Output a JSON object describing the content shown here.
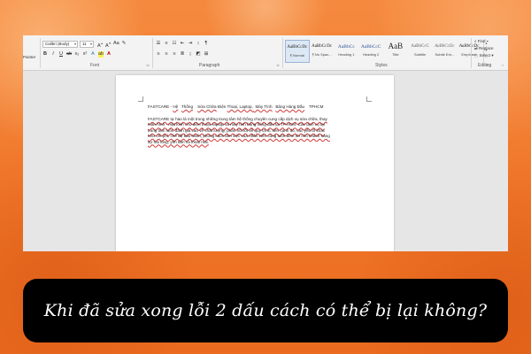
{
  "ribbon": {
    "clipboard_label": "Painter",
    "font": {
      "name": "Calibri (Body)",
      "size": "11",
      "group_label": "Font"
    },
    "paragraph_label": "Paragraph",
    "styles": {
      "group_label": "Styles",
      "items": [
        {
          "preview": "AaBbCcDc",
          "name": "¶ Normal"
        },
        {
          "preview": "AaBbCcDc",
          "name": "¶ No Spac..."
        },
        {
          "preview": "AaBbCc",
          "name": "Heading 1"
        },
        {
          "preview": "AaBbCcC",
          "name": "Heading 2"
        },
        {
          "preview": "AaB",
          "name": "Title"
        },
        {
          "preview": "AaBbCcC",
          "name": "Subtitle"
        },
        {
          "preview": "AaBbCcDc",
          "name": "Subtle Em..."
        },
        {
          "preview": "AaBbCcDc",
          "name": "Emphasis"
        }
      ]
    },
    "editing": {
      "find": "Find",
      "replace": "Replace",
      "select": "Select",
      "group_label": "Editing"
    }
  },
  "document": {
    "heading_line": [
      "FASTCARE - ",
      "Hệ",
      "   ",
      "Thống",
      "    ",
      "Sửa Chữa",
      " Điện ",
      "Thoại, Laptop,",
      "  Máy Tính",
      "   ",
      "Bảng Hàng Đầu",
      "    TPHCM"
    ],
    "body_lines": [
      "FASTCARE  tự hào là  một trong những trung tâm  hệ thống chuyên  cung cấp dịch vụ sửa chữa, thay",
      "màn hình - mặt kính   cho điện thoại, laptop  và máy tính   bảng hàng  đầu tại TP.HCM. Các  dịch vụ tại",
      "trung tâm luôn    đánh giá cao về   chất lượng,   phản hồi tốt về quy trình, liên cạnh đó, các yếu tố khác",
      "như chi phí, chế độ bảo hành, phong cách  làm   việc của nhân viên cũng   luôn đem tới cho khách hàng",
      "sự hài lòng,  yên tâm và thoải   mái."
    ]
  },
  "caption": "Khi đã sửa xong lỗi 2 dấu cách có thể bị lại không?"
}
